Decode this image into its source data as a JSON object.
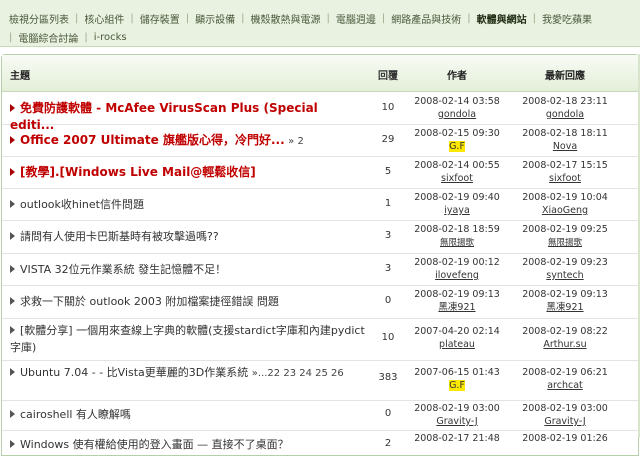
{
  "nav": {
    "row1": [
      "檢視分區列表",
      "核心組件",
      "儲存裝置",
      "顯示設備",
      "機殼散熱與電源",
      "電腦週邊",
      "網路產品與技術",
      "軟體與網站",
      "我愛吃蘋果"
    ],
    "row2": [
      "電腦綜合討論",
      "i-rocks"
    ],
    "active": "軟體與網站"
  },
  "table": {
    "headers": {
      "topic": "主題",
      "replies": "回覆",
      "author": "作者",
      "last": "最新回應"
    },
    "rows": [
      {
        "title": "免費防護軟體 - McAfee VirusScan Plus (Special editi...",
        "pages": "",
        "replies": "10",
        "author_date": "2008-02-14 03:58",
        "author": "gondola",
        "last_date": "2008-02-18 23:11",
        "last_user": "gondola"
      },
      {
        "title": "Office 2007 Ultimate 旗艦版心得，冷門好...",
        "pages": "» 2",
        "replies": "29",
        "author_date": "2008-02-15 09:30",
        "author": "G.F",
        "last_date": "2008-02-18 18:11",
        "last_user": "Nova"
      },
      {
        "title": "[教學].[Windows Live Mail@輕鬆收信]",
        "pages": "",
        "replies": "5",
        "author_date": "2008-02-14 00:55",
        "author": "sixfoot",
        "last_date": "2008-02-17 15:15",
        "last_user": "sixfoot"
      },
      {
        "title": "outlook收hinet信件問題",
        "pages": "",
        "replies": "1",
        "author_date": "2008-02-19 09:40",
        "author": "iyaya",
        "last_date": "2008-02-19 10:04",
        "last_user": "XiaoGeng"
      },
      {
        "title": "請問有人使用卡巴斯基時有被攻擊過嗎??",
        "pages": "",
        "replies": "3",
        "author_date": "2008-02-18 18:59",
        "author": "無限揚歌",
        "last_date": "2008-02-19 09:25",
        "last_user": "無限揚歌"
      },
      {
        "title": "VISTA 32位元作業系統 發生記憶體不足！",
        "pages": "",
        "replies": "3",
        "author_date": "2008-02-19 00:12",
        "author": "ilovefeng",
        "last_date": "2008-02-19 09:23",
        "last_user": "syntech"
      },
      {
        "title": "求救一下關於 outlook 2003 附加檔案捷徑錯誤 問題",
        "pages": "",
        "replies": "0",
        "author_date": "2008-02-19 09:13",
        "author": "黑凍921",
        "last_date": "2008-02-19 09:13",
        "last_user": "黑凍921"
      },
      {
        "title": "[軟體分享] 一個用來查線上字典的軟體(支援stardict字庫和內建pydict字庫)",
        "pages": "",
        "replies": "10",
        "author_date": "2007-04-20 02:14",
        "author": "plateau",
        "last_date": "2008-02-19 08:22",
        "last_user": "Arthur.su"
      },
      {
        "title": "Ubuntu 7.04 - - 比Vista更華麗的3D作業系統",
        "pages": "»...22 23 24 25 26",
        "replies": "383",
        "author_date": "2007-06-15 01:43",
        "author": "G.F",
        "last_date": "2008-02-19 06:21",
        "last_user": "archcat"
      },
      {
        "title": "cairoshell 有人瞭解嗎",
        "pages": "",
        "replies": "0",
        "author_date": "2008-02-19 03:00",
        "author": "Gravity-J",
        "last_date": "2008-02-19 03:00",
        "last_user": "Gravity-J"
      },
      {
        "title": "Windows 使有權給使用的登入畫面 — 直接不了桌面？",
        "pages": "",
        "replies": "2",
        "author_date": "2008-02-17 21:48",
        "author": "",
        "last_date": "2008-02-19 01:26",
        "last_user": ""
      }
    ]
  }
}
